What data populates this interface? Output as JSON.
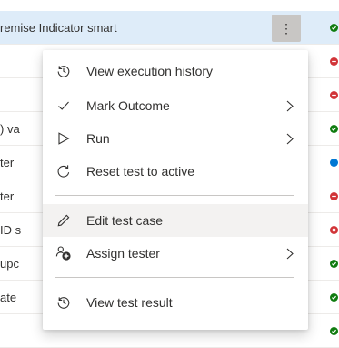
{
  "grid": {
    "rows": [
      {
        "title": "remise Indicator smart",
        "status": "passed"
      },
      {
        "title": "",
        "status": "failed"
      },
      {
        "title": "",
        "status": "failed"
      },
      {
        "title": ") va",
        "status": "passed"
      },
      {
        "title": "ter",
        "status": "active"
      },
      {
        "title": "ter",
        "status": "failed"
      },
      {
        "title": "ID s",
        "status": "blocked"
      },
      {
        "title": "upc",
        "status": "passed"
      },
      {
        "title": "ate",
        "status": "passed"
      },
      {
        "title": "",
        "status": "passed"
      }
    ],
    "more_button_glyph": "⋮"
  },
  "context_menu": {
    "items": [
      {
        "label": "View execution history",
        "icon": "history-icon"
      },
      {
        "label": "Mark Outcome",
        "icon": "checkmark-icon",
        "submenu": true
      },
      {
        "label": "Run",
        "icon": "play-icon",
        "submenu": true
      },
      {
        "label": "Reset test to active",
        "icon": "reset-icon"
      },
      {
        "label": "Edit test case",
        "icon": "pencil-icon"
      },
      {
        "label": "Assign tester",
        "icon": "assign-person-icon",
        "submenu": true
      },
      {
        "label": "View test result",
        "icon": "history-icon"
      }
    ]
  },
  "colors": {
    "passed": "#107c10",
    "failed": "#d13438",
    "active": "#0078d4",
    "selected_row": "#deecf9"
  }
}
